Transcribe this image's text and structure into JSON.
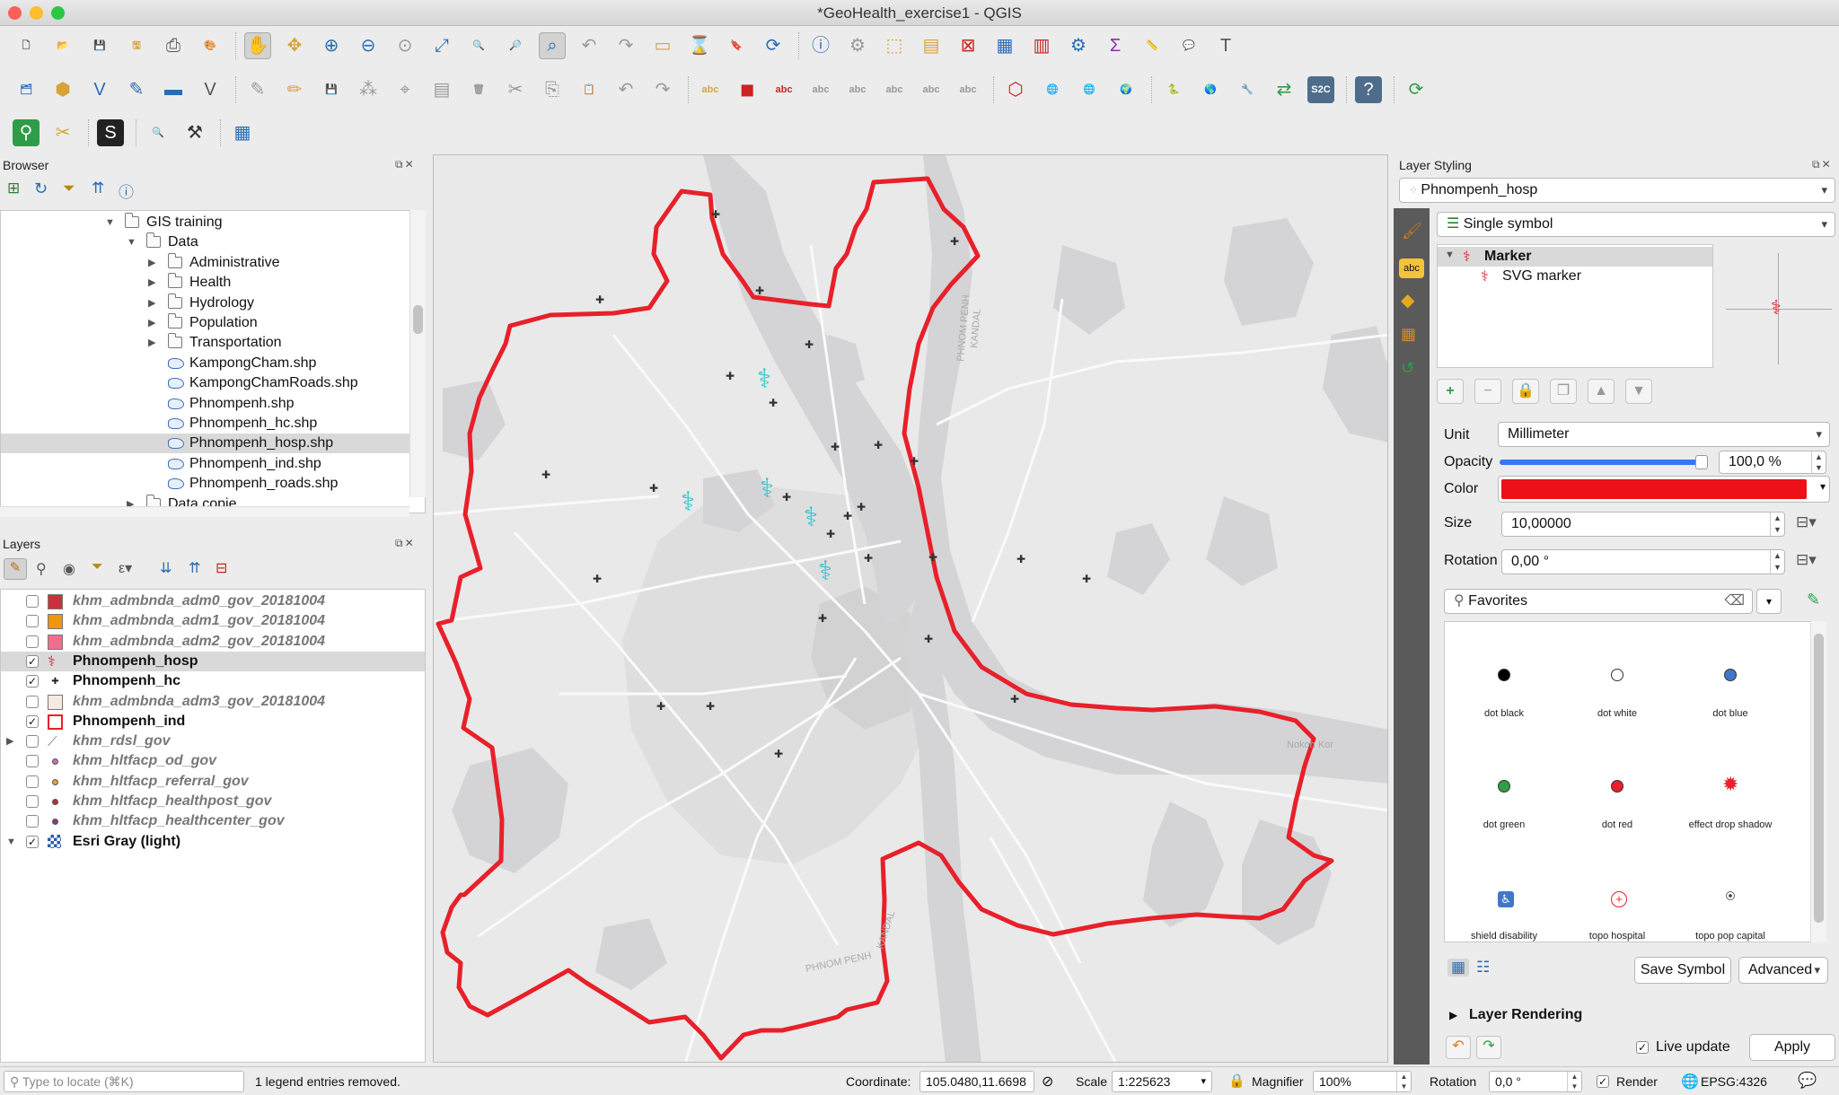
{
  "window": {
    "title": "*GeoHealth_exercise1 - QGIS"
  },
  "browser": {
    "title": "Browser",
    "items": [
      {
        "label": "GIS training",
        "type": "folder",
        "depth": 0,
        "expanded": true
      },
      {
        "label": "Data",
        "type": "folder",
        "depth": 1,
        "expanded": true
      },
      {
        "label": "Administrative",
        "type": "folder",
        "depth": 2
      },
      {
        "label": "Health",
        "type": "folder",
        "depth": 2
      },
      {
        "label": "Hydrology",
        "type": "folder",
        "depth": 2
      },
      {
        "label": "Population",
        "type": "folder",
        "depth": 2
      },
      {
        "label": "Transportation",
        "type": "folder",
        "depth": 2
      },
      {
        "label": "KampongCham.shp",
        "type": "shp",
        "depth": 2
      },
      {
        "label": "KampongChamRoads.shp",
        "type": "shp",
        "depth": 2
      },
      {
        "label": "Phnompenh.shp",
        "type": "shp",
        "depth": 2
      },
      {
        "label": "Phnompenh_hc.shp",
        "type": "shp",
        "depth": 2
      },
      {
        "label": "Phnompenh_hosp.shp",
        "type": "shp",
        "depth": 2,
        "selected": true
      },
      {
        "label": "Phnompenh_ind.shp",
        "type": "shp",
        "depth": 2
      },
      {
        "label": "Phnompenh_roads.shp",
        "type": "shp",
        "depth": 2
      },
      {
        "label": "Data copie",
        "type": "folder",
        "depth": 1
      }
    ]
  },
  "layers": {
    "title": "Layers",
    "items": [
      {
        "label": "khm_admbnda_adm0_gov_20181004",
        "checked": false,
        "symbol": "fill",
        "color": "#c8323f",
        "style": "gray"
      },
      {
        "label": "khm_admbnda_adm1_gov_20181004",
        "checked": false,
        "symbol": "fill",
        "color": "#f0950e",
        "style": "gray"
      },
      {
        "label": "khm_admbnda_adm2_gov_20181004",
        "checked": false,
        "symbol": "fill",
        "color": "#ef6f8e",
        "style": "gray"
      },
      {
        "label": "Phnompenh_hosp",
        "checked": true,
        "symbol": "hospital",
        "color": "#e8202a",
        "style": "bold",
        "selected": true
      },
      {
        "label": "Phnompenh_hc",
        "checked": true,
        "symbol": "cross",
        "color": "#222222",
        "style": "bold"
      },
      {
        "label": "khm_admbnda_adm3_gov_20181004",
        "checked": false,
        "symbol": "fill",
        "color": "#f6e9df",
        "style": "gray"
      },
      {
        "label": "Phnompenh_ind",
        "checked": true,
        "symbol": "outline",
        "color": "#e8202a",
        "style": "bold"
      },
      {
        "label": "khm_rdsl_gov",
        "checked": false,
        "symbol": "line",
        "color": "#777777",
        "style": "gray",
        "expandable": true
      },
      {
        "label": "khm_hltfacp_od_gov",
        "checked": false,
        "symbol": "dot",
        "color": "#c86fb5",
        "style": "gray"
      },
      {
        "label": "khm_hltfacp_referral_gov",
        "checked": false,
        "symbol": "dot",
        "color": "#e8a33a",
        "style": "gray"
      },
      {
        "label": "khm_hltfacp_healthpost_gov",
        "checked": false,
        "symbol": "dot",
        "color": "#b03040",
        "style": "gray"
      },
      {
        "label": "khm_hltfacp_healthcenter_gov",
        "checked": false,
        "symbol": "dot",
        "color": "#8a3a8a",
        "style": "gray"
      },
      {
        "label": "Esri Gray (light)",
        "checked": true,
        "symbol": "raster",
        "color": "#2b5da8",
        "style": "bold",
        "expandable": true,
        "expanded": true
      }
    ]
  },
  "map": {
    "river_labels": [
      "PHNOM PENH",
      "KANDAL",
      "PHNOM PENH",
      "KANDAL",
      "Nokoh Kor"
    ],
    "boundary_color": "#e8202a",
    "hospital_color": "#33c6cf"
  },
  "styling": {
    "title": "Layer Styling",
    "layer": "Phnompenh_hosp",
    "renderer": "Single symbol",
    "symbol_tree": [
      "Marker",
      "SVG marker"
    ],
    "unit_label": "Unit",
    "unit": "Millimeter",
    "opacity_label": "Opacity",
    "opacity": "100,0 %",
    "opacity_fraction": 1.0,
    "color_label": "Color",
    "color": "#ee1018",
    "size_label": "Size",
    "size": "10,00000",
    "rotation_label": "Rotation",
    "rotation": "0,00 °",
    "search": "Favorites",
    "favorites": [
      {
        "label": "dot  black",
        "kind": "dot",
        "color": "#000000"
      },
      {
        "label": "dot  white",
        "kind": "ring",
        "color": "#ffffff"
      },
      {
        "label": "dot  blue",
        "kind": "dot",
        "color": "#3f78c8"
      },
      {
        "label": "dot  green",
        "kind": "dot",
        "color": "#2ea043"
      },
      {
        "label": "dot  red",
        "kind": "dot",
        "color": "#e8202a"
      },
      {
        "label": "effect  drop  shadow",
        "kind": "star",
        "color": "#e8202a"
      },
      {
        "label": "shield  disability",
        "kind": "wheelchair",
        "color": "#3f78c8"
      },
      {
        "label": "topo  hospital",
        "kind": "hospital",
        "color": "#e8202a"
      },
      {
        "label": "topo  pop  capital",
        "kind": "capital",
        "color": "#444444"
      }
    ],
    "save_symbol": "Save Symbol",
    "advanced": "Advanced",
    "layer_rendering": "Layer Rendering",
    "live_update": "Live update",
    "apply": "Apply"
  },
  "status": {
    "locate_placeholder": "Type to locate (⌘K)",
    "message": "1 legend entries removed.",
    "coordinate_label": "Coordinate:",
    "coordinate": "105.0480,11.6698",
    "scale_label": "Scale",
    "scale": "1:225623",
    "magnifier_label": "Magnifier",
    "magnifier": "100%",
    "rotation_label": "Rotation",
    "rotation": "0,0 °",
    "render_label": "Render",
    "crs": "EPSG:4326"
  }
}
